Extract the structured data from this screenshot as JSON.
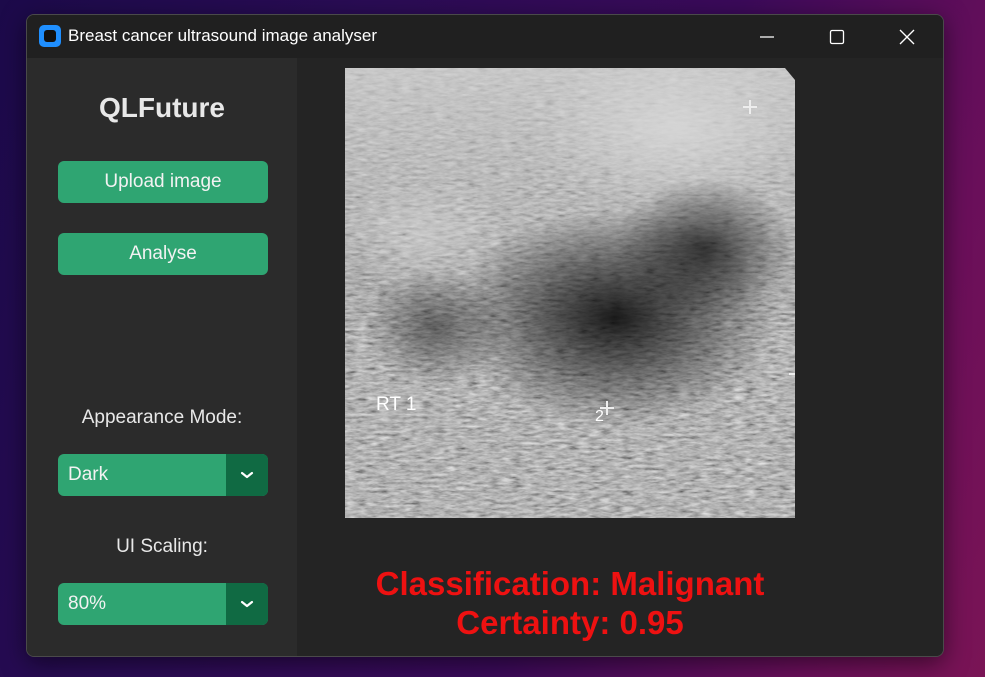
{
  "window": {
    "title": "Breast cancer ultrasound image analyser",
    "icon": "app-icon"
  },
  "sidebar": {
    "brand": "QLFuture",
    "upload_label": "Upload image",
    "analyse_label": "Analyse",
    "appearance_label": "Appearance Mode:",
    "appearance_value": "Dark",
    "scaling_label": "UI Scaling:",
    "scaling_value": "80%"
  },
  "image": {
    "overlay_label": "RT 1",
    "marker_label": "2"
  },
  "result": {
    "classification": "Classification: Malignant",
    "certainty": "Certainty: 0.95"
  },
  "colors": {
    "accent": "#2fa572",
    "accent_dark": "#106a43",
    "result": "#ee1111"
  }
}
